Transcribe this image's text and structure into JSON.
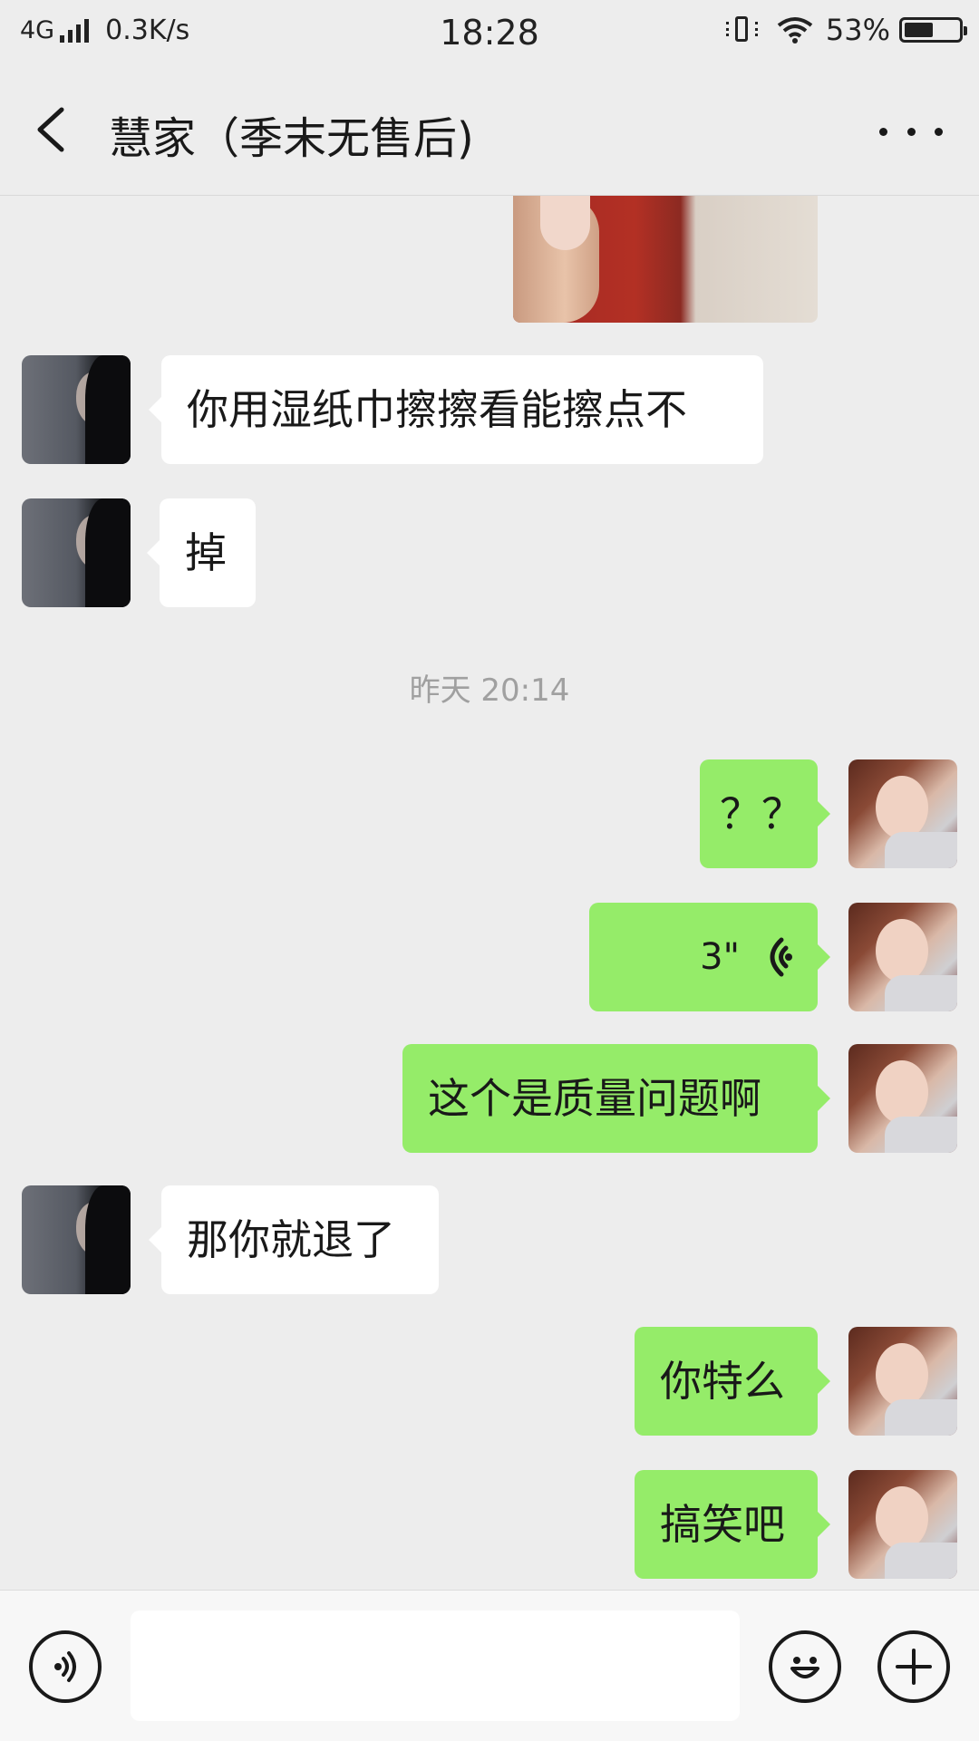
{
  "status_bar": {
    "network": "4G",
    "speed": "0.3K/s",
    "time": "18:28",
    "battery_percent": "53%",
    "battery_level": 0.53,
    "icons": [
      "signal-icon",
      "vibrate-icon",
      "wifi-icon",
      "battery-icon"
    ]
  },
  "header": {
    "title": "慧家（季末无售后)",
    "back_icon": "chevron-left-icon",
    "more_icon": "more-dots-icon"
  },
  "messages": [
    {
      "side": "out",
      "type": "image"
    },
    {
      "side": "in",
      "text": "你用湿纸巾擦擦看能擦点不"
    },
    {
      "side": "in",
      "text": "掉"
    },
    {
      "type": "time",
      "text": "昨天 20:14"
    },
    {
      "side": "out",
      "text": "？？"
    },
    {
      "side": "out",
      "type": "voice",
      "text": "3\""
    },
    {
      "side": "out",
      "text": "这个是质量问题啊"
    },
    {
      "side": "in",
      "text": "那你就退了"
    },
    {
      "side": "out",
      "text": "你特么"
    },
    {
      "side": "out",
      "text": "搞笑吧"
    }
  ],
  "input_bar": {
    "placeholder": "",
    "icons": [
      "voice-input-icon",
      "emoji-icon",
      "plus-icon"
    ]
  }
}
